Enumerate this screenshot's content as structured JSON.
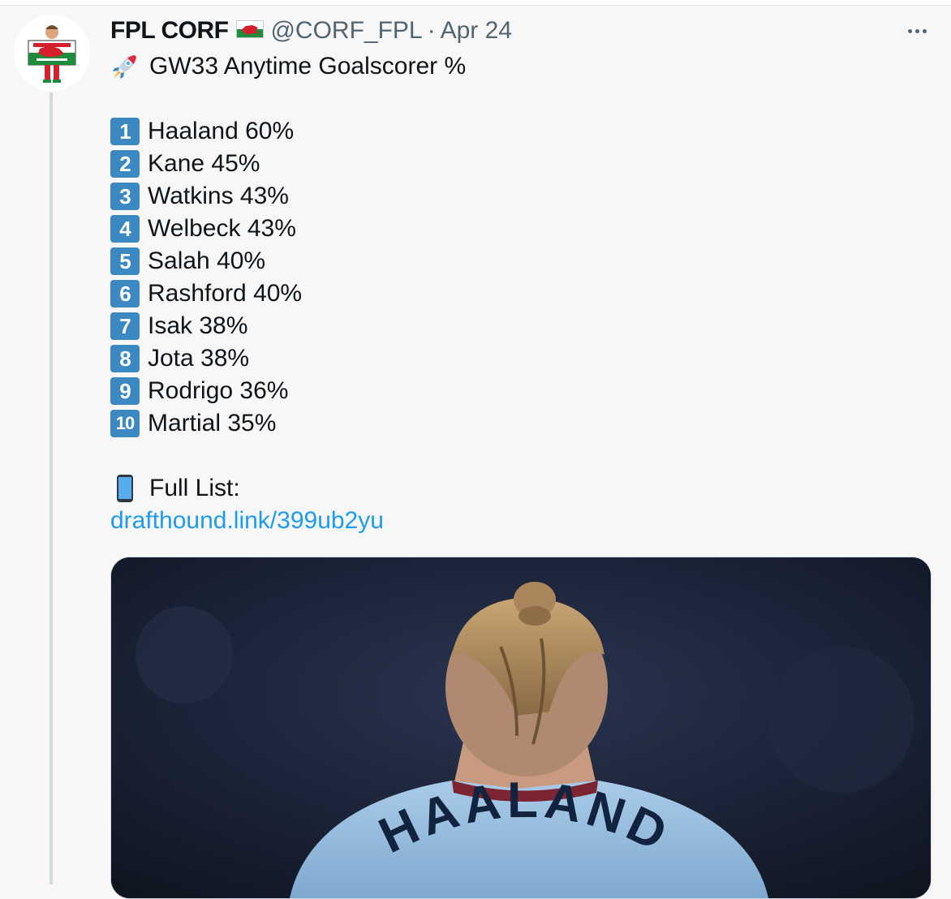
{
  "tweet": {
    "display_name": "FPL CORF",
    "handle": "@CORF_FPL",
    "separator": "·",
    "date": "Apr 24",
    "title_line": "GW33 Anytime Goalscorer %",
    "ranking": [
      {
        "rank": "1",
        "text": "Haaland 60%"
      },
      {
        "rank": "2",
        "text": "Kane 45%"
      },
      {
        "rank": "3",
        "text": "Watkins 43%"
      },
      {
        "rank": "4",
        "text": "Welbeck 43%"
      },
      {
        "rank": "5",
        "text": "Salah 40%"
      },
      {
        "rank": "6",
        "text": "Rashford 40%"
      },
      {
        "rank": "7",
        "text": "Isak 38%"
      },
      {
        "rank": "8",
        "text": "Jota 38%"
      },
      {
        "rank": "9",
        "text": "Rodrigo 36%"
      },
      {
        "rank": "10",
        "text": "Martial 35%"
      }
    ],
    "full_list_label": "Full List:",
    "link": "drafthound.link/399ub2yu",
    "media_shirt_text": "HAALAND"
  },
  "icons": {
    "title_emoji": "rocket-icon",
    "full_list_emoji": "mobile-phone-icon",
    "flag": "wales-flag-icon",
    "menu": "more-options-icon"
  },
  "colors": {
    "link": "#1d9bf0",
    "keycap": "#3b88c3",
    "secondary_text": "#536471"
  }
}
